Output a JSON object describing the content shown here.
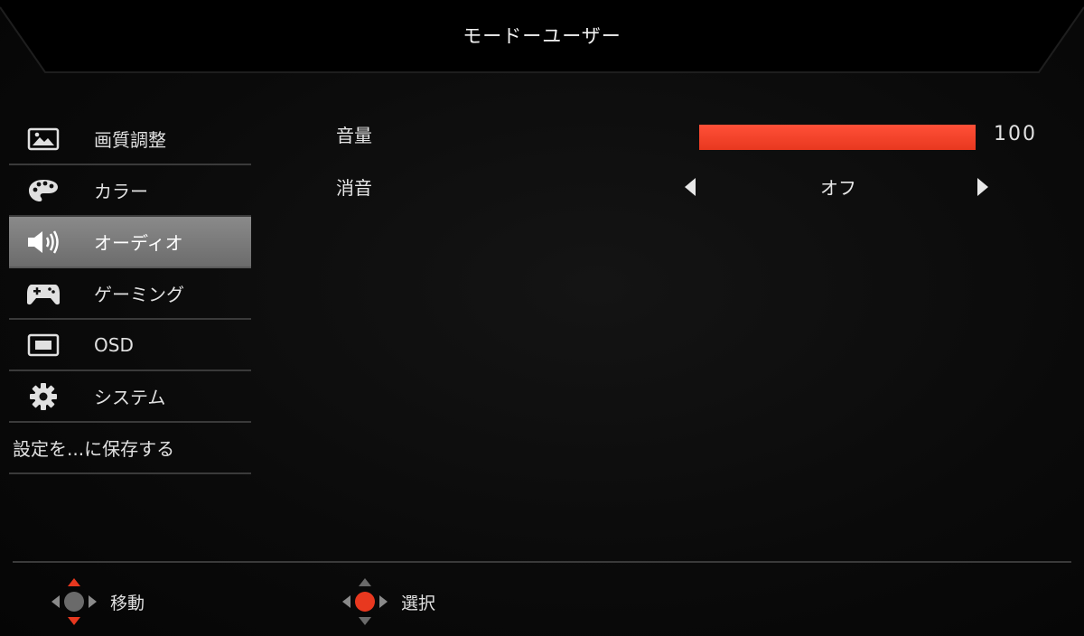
{
  "header": {
    "title": "モードーユーザー"
  },
  "sidebar": {
    "items": [
      {
        "label": "画質調整",
        "icon": "picture-icon",
        "active": false
      },
      {
        "label": "カラー",
        "icon": "palette-icon",
        "active": false
      },
      {
        "label": "オーディオ",
        "icon": "speaker-icon",
        "active": true
      },
      {
        "label": "ゲーミング",
        "icon": "gamepad-icon",
        "active": false
      },
      {
        "label": "OSD",
        "icon": "osd-window-icon",
        "active": false
      },
      {
        "label": "システム",
        "icon": "gear-icon",
        "active": false
      }
    ],
    "save_label": "設定を...に保存する"
  },
  "audio": {
    "volume_label": "音量",
    "volume_value": "100",
    "volume_percent": 100,
    "mute_label": "消音",
    "mute_value": "オフ"
  },
  "footer": {
    "move_label": "移動",
    "select_label": "選択"
  },
  "colors": {
    "accent": "#e8381f",
    "active_item": "#7c7c7c"
  }
}
